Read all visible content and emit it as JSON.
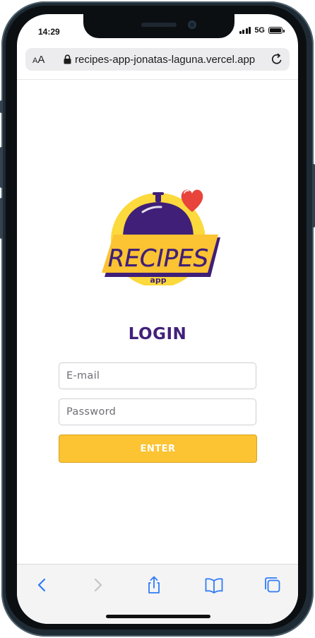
{
  "status_bar": {
    "time": "14:29",
    "network": "5G"
  },
  "browser": {
    "text_size_label_large": "A",
    "text_size_label_small": "A",
    "url": "recipes-app-jonatas-laguna.vercel.app"
  },
  "logo": {
    "title": "RECIPES",
    "subtitle": "app"
  },
  "login": {
    "title": "LOGIN",
    "email_placeholder": "E-mail",
    "password_placeholder": "Password",
    "enter_label": "ENTER"
  },
  "colors": {
    "brand_purple": "#41207a",
    "brand_yellow": "#fcc332",
    "heart_red": "#e8443c",
    "safari_blue": "#2f7bf5"
  },
  "toolbar": {
    "icons": [
      "back-icon",
      "forward-icon",
      "share-icon",
      "bookmarks-icon",
      "tabs-icon"
    ]
  }
}
